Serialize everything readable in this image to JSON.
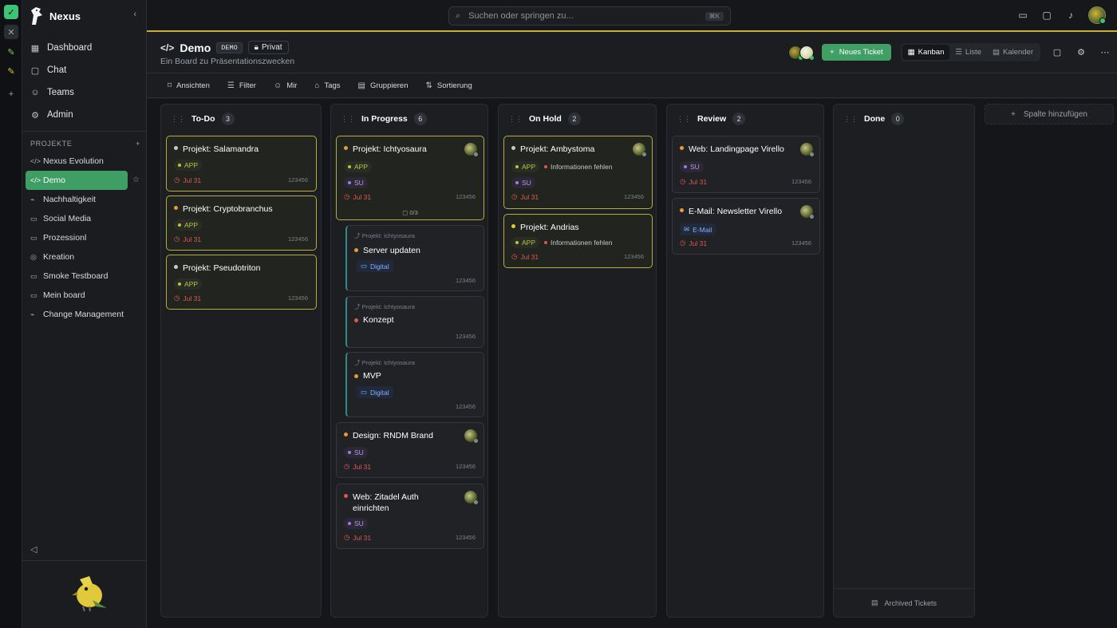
{
  "app": {
    "name": "Nexus"
  },
  "nav": [
    {
      "label": "Dashboard",
      "icon": "grid-icon"
    },
    {
      "label": "Chat",
      "icon": "chat-icon"
    },
    {
      "label": "Teams",
      "icon": "users-icon"
    },
    {
      "label": "Admin",
      "icon": "admin-icon"
    }
  ],
  "projects_header": "PROJEKTE",
  "projects": [
    {
      "label": "Nexus Evolution"
    },
    {
      "label": "Demo"
    },
    {
      "label": "Nachhaltigkeit"
    },
    {
      "label": "Social Media"
    },
    {
      "label": "Prozessionl"
    },
    {
      "label": "Kreation"
    },
    {
      "label": "Smoke Testboard"
    },
    {
      "label": "Mein board"
    },
    {
      "label": "Change Management"
    }
  ],
  "search": {
    "placeholder": "Suchen oder springen zu...",
    "shortcut": "⌘K"
  },
  "board": {
    "title": "Demo",
    "badge": "DEMO",
    "privacy": "Privat",
    "subtitle": "Ein Board zu Präsentationszwecken",
    "new_ticket": "Neues Ticket"
  },
  "views": [
    "Kanban",
    "Liste",
    "Kalender"
  ],
  "toolbar": [
    "Ansichten",
    "Filter",
    "Mir",
    "Tags",
    "Gruppieren",
    "Sortierung"
  ],
  "add_column": "Spalte hinzufügen",
  "archived": "Archived Tickets",
  "columns": [
    {
      "title": "To-Do",
      "count": "3",
      "cards": [
        {
          "title": "Projekt: Salamandra",
          "tags": [
            "APP"
          ],
          "due": "Jul 31",
          "id": "123456"
        },
        {
          "title": "Projekt: Cryptobranchus",
          "tags": [
            "APP"
          ],
          "due": "Jul 31",
          "id": "123456"
        },
        {
          "title": "Projekt: Pseudotriton",
          "tags": [
            "APP"
          ],
          "due": "Jul 31",
          "id": "123456"
        }
      ]
    },
    {
      "title": "In Progress",
      "count": "6",
      "cards": [
        {
          "title": "Projekt: Ichtyosaura",
          "tags": [
            "APP",
            "SU"
          ],
          "due": "Jul 31",
          "id": "123456",
          "subtasks": "0/3"
        },
        {
          "parent": "Projekt: Ichtyosaura",
          "title": "Server updaten",
          "tags": [
            "Digital"
          ],
          "id": "123456"
        },
        {
          "parent": "Projekt: Ichtyosaura",
          "title": "Konzept",
          "id": "123456"
        },
        {
          "parent": "Projekt: Ichtyosaura",
          "title": "MVP",
          "tags": [
            "Digital"
          ],
          "id": "123456"
        },
        {
          "title": "Design: RNDM Brand",
          "tags": [
            "SU"
          ],
          "due": "Jul 31",
          "id": "123456"
        },
        {
          "title": "Web: Zitadel Auth einrichten",
          "tags": [
            "SU"
          ],
          "due": "Jul 31",
          "id": "123456"
        }
      ]
    },
    {
      "title": "On Hold",
      "count": "2",
      "cards": [
        {
          "title": "Projekt: Ambystoma",
          "tags": [
            "APP",
            "Informationen fehlen",
            "SU"
          ],
          "due": "Jul 31",
          "id": "123456"
        },
        {
          "title": "Projekt: Andrias",
          "tags": [
            "APP",
            "Informationen fehlen"
          ],
          "due": "Jul 31",
          "id": "123456"
        }
      ]
    },
    {
      "title": "Review",
      "count": "2",
      "cards": [
        {
          "title": "Web: Landingpage Virello",
          "tags": [
            "SU"
          ],
          "due": "Jul 31",
          "id": "123456"
        },
        {
          "title": "E-Mail: Newsletter Virello",
          "tags": [
            "E-Mail"
          ],
          "due": "Jul 31",
          "id": "123456"
        }
      ]
    },
    {
      "title": "Done",
      "count": "0",
      "cards": []
    }
  ]
}
